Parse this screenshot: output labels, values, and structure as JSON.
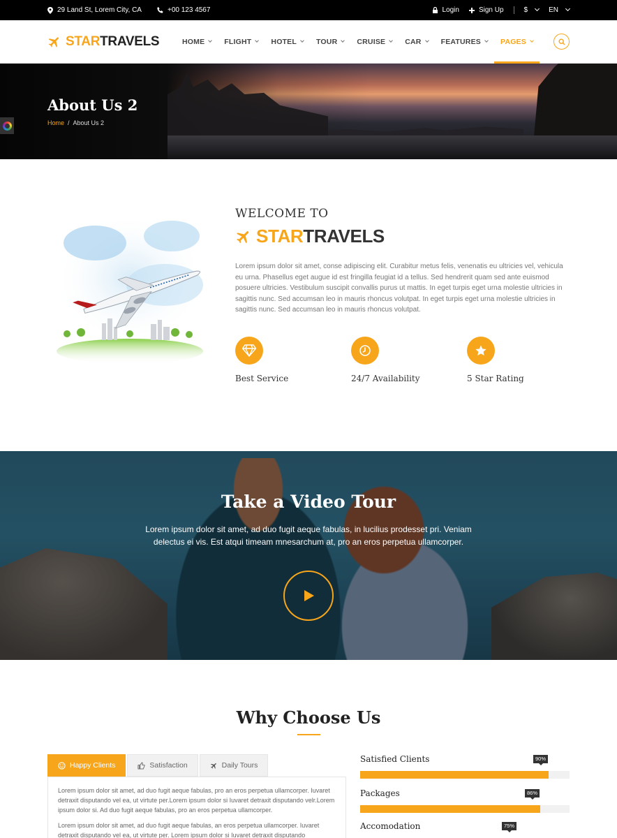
{
  "topbar": {
    "address": "29 Land St, Lorem City, CA",
    "phone": "+00 123 4567",
    "login": "Login",
    "signup": "Sign Up",
    "currency": "$",
    "language": "EN"
  },
  "brand": {
    "part1": "STAR",
    "part2": "TRAVELS"
  },
  "nav": {
    "items": [
      {
        "label": "HOME"
      },
      {
        "label": "FLIGHT"
      },
      {
        "label": "HOTEL"
      },
      {
        "label": "TOUR"
      },
      {
        "label": "CRUISE"
      },
      {
        "label": "CAR"
      },
      {
        "label": "FEATURES"
      },
      {
        "label": "PAGES"
      }
    ],
    "active": "PAGES"
  },
  "hero": {
    "title": "About Us 2",
    "breadcrumb_home": "Home",
    "breadcrumb_sep": "/",
    "breadcrumb_current": "About Us 2"
  },
  "welcome": {
    "heading": "WELCOME TO",
    "brand_part1": "STAR",
    "brand_part2": "TRAVELS",
    "body": "Lorem ipsum dolor sit amet, conse adipiscing elit. Curabitur metus felis, venenatis eu ultricies vel, vehicula eu urna. Phasellus eget augue id est fringilla feugiat id a tellus. Sed hendrerit quam sed ante euismod posuere ultricies. Vestibulum suscipit convallis purus ut mattis. In eget turpis eget urna molestie ultricies in sagittis nunc. Sed accumsan leo in mauris rhoncus volutpat. In eget turpis eget urna molestie ultricies in sagittis nunc. Sed accumsan leo in mauris rhoncus volutpat.",
    "features": [
      {
        "label": "Best Service",
        "icon": "diamond-icon"
      },
      {
        "label": "24/7 Availability",
        "icon": "clock-icon"
      },
      {
        "label": "5 Star Rating",
        "icon": "star-icon"
      }
    ]
  },
  "video": {
    "title": "Take a Video Tour",
    "text": "Lorem ipsum dolor sit amet, ad duo fugit aeque fabulas, in lucilius prodesset pri. Veniam delectus ei vis. Est atqui timeam mnesarchum at, pro an eros perpetua ullamcorper."
  },
  "why": {
    "title": "Why Choose Us",
    "tabs": [
      {
        "label": "Happy Clients",
        "icon": "smiley-icon"
      },
      {
        "label": "Satisfaction",
        "icon": "thumbs-up-icon"
      },
      {
        "label": "Daily Tours",
        "icon": "plane-icon"
      }
    ],
    "active_tab": "Happy Clients",
    "panel_p1": "Lorem ipsum dolor sit amet, ad duo fugit aeque fabulas, pro an eros perpetua ullamcorper. Iuvaret detraxit disputando vel ea, ut virtute per.Lorem ipsum dolor si Iuvaret detraxit disputando velr.Lorem ipsum dolor si. Ad duo fugit aeque fabulas, pro an eros perpetua ullamcorper.",
    "panel_p2": "Lorem ipsum dolor sit amet, ad duo fugit aeque fabulas, an eros perpetua ullamcorper. Iuvaret detraxit disputando vel ea, ut virtute per. Lorem ipsum dolor si Iuvaret detraxit disputando",
    "skills": [
      {
        "name": "Satisfied Clients",
        "percent": 90,
        "label": "90%"
      },
      {
        "name": "Packages",
        "percent": 86,
        "label": "86%"
      },
      {
        "name": "Accomodation",
        "percent": 75,
        "label": "75%"
      }
    ]
  },
  "colors": {
    "accent": "#f7a61c",
    "dark": "#222222"
  }
}
